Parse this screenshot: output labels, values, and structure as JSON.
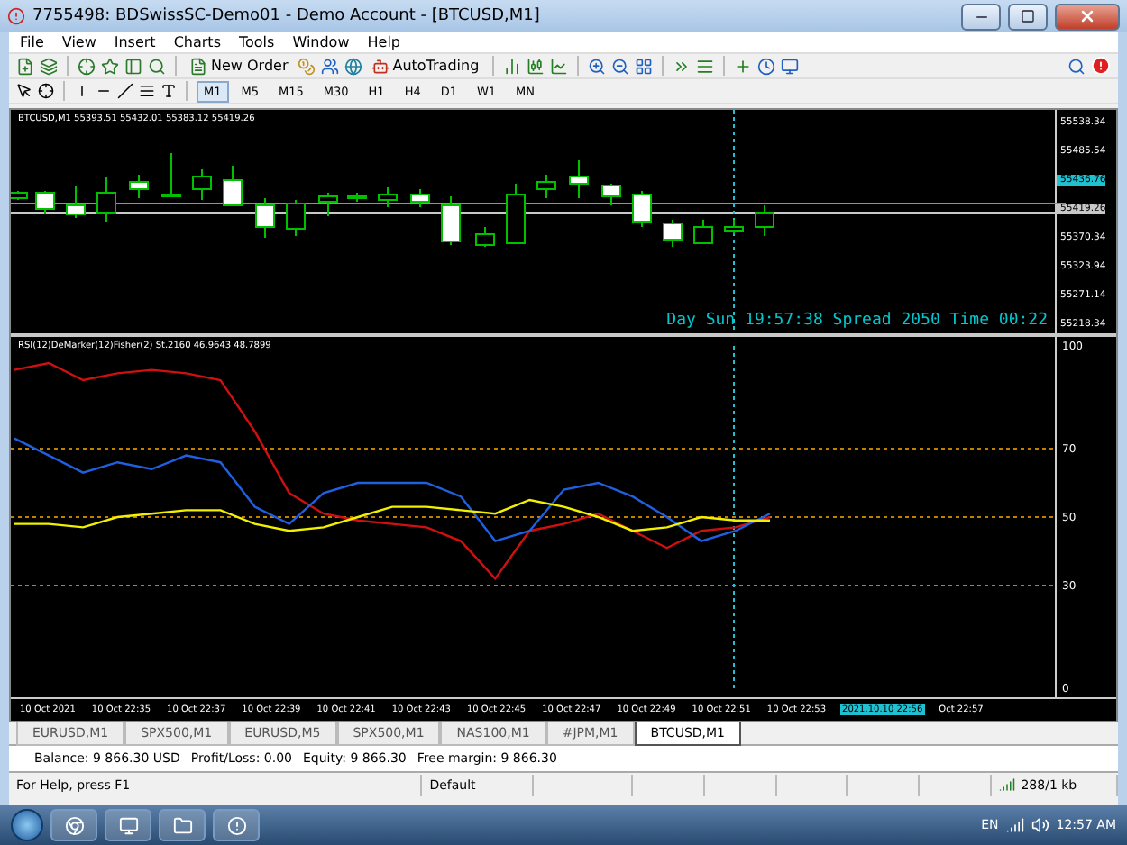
{
  "window": {
    "title": "7755498: BDSwissSC-Demo01 - Demo Account - [BTCUSD,M1]"
  },
  "menu": [
    "File",
    "View",
    "Insert",
    "Charts",
    "Tools",
    "Window",
    "Help"
  ],
  "toolbar": {
    "new_order": "New Order",
    "auto_trading": "AutoTrading"
  },
  "timeframes": [
    {
      "label": "M1",
      "selected": true
    },
    {
      "label": "M5",
      "selected": false
    },
    {
      "label": "M15",
      "selected": false
    },
    {
      "label": "M30",
      "selected": false
    },
    {
      "label": "H1",
      "selected": false
    },
    {
      "label": "H4",
      "selected": false
    },
    {
      "label": "D1",
      "selected": false
    },
    {
      "label": "W1",
      "selected": false
    },
    {
      "label": "MN",
      "selected": false
    }
  ],
  "chart": {
    "symbol": "BTCUSD,M1",
    "ohlc": "55393.51 55432.01 55383.12 55419.26",
    "info": "Day Sun 19:57:38 Spread 2050 Time 00:22",
    "price_ticks": [
      {
        "label": "55538.34",
        "kind": "plain"
      },
      {
        "label": "55485.54",
        "kind": "plain"
      },
      {
        "label": "55436.76",
        "kind": "ask"
      },
      {
        "label": "55419.26",
        "kind": "bid"
      },
      {
        "label": "55370.34",
        "kind": "plain"
      },
      {
        "label": "55323.94",
        "kind": "plain"
      },
      {
        "label": "55271.14",
        "kind": "plain"
      },
      {
        "label": "55218.34",
        "kind": "plain"
      }
    ]
  },
  "indicator": {
    "label": "RSI(12)DeMarker(12)Fisher(2) St.2160 46.9643 48.7899",
    "chart_data": {
      "type": "line",
      "grid": true,
      "ylim": [
        0,
        100
      ],
      "yticks": [
        {
          "value": 0,
          "label": "0"
        },
        {
          "value": 30,
          "label": "30"
        },
        {
          "value": 50,
          "label": "50"
        },
        {
          "value": 70,
          "label": "70"
        },
        {
          "value": 100,
          "label": "100"
        }
      ],
      "series": [
        {
          "color": "#d01010",
          "values": [
            93,
            95,
            90,
            92,
            93,
            92,
            90,
            75,
            57,
            51,
            49,
            48,
            47,
            43,
            32,
            46,
            48,
            51,
            46,
            41,
            46,
            47,
            50
          ]
        },
        {
          "color": "#2060e0",
          "values": [
            73,
            68,
            63,
            66,
            64,
            68,
            66,
            53,
            48,
            57,
            60,
            60,
            60,
            56,
            43,
            46,
            58,
            60,
            56,
            50,
            43,
            46,
            51
          ]
        },
        {
          "color": "#f0f000",
          "values": [
            48,
            48,
            47,
            50,
            51,
            52,
            52,
            48,
            46,
            47,
            50,
            53,
            53,
            52,
            51,
            55,
            53,
            50,
            46,
            47,
            50,
            49,
            49
          ]
        }
      ]
    }
  },
  "time_axis": [
    {
      "label": "10 Oct 2021",
      "selected": false
    },
    {
      "label": "10 Oct 22:35",
      "selected": false
    },
    {
      "label": "10 Oct 22:37",
      "selected": false
    },
    {
      "label": "10 Oct 22:39",
      "selected": false
    },
    {
      "label": "10 Oct 22:41",
      "selected": false
    },
    {
      "label": "10 Oct 22:43",
      "selected": false
    },
    {
      "label": "10 Oct 22:45",
      "selected": false
    },
    {
      "label": "10 Oct 22:47",
      "selected": false
    },
    {
      "label": "10 Oct 22:49",
      "selected": false
    },
    {
      "label": "10 Oct 22:51",
      "selected": false
    },
    {
      "label": "10 Oct 22:53",
      "selected": false
    },
    {
      "label": "2021.10.10 22:56",
      "selected": true
    },
    {
      "label": "Oct 22:57",
      "selected": false
    }
  ],
  "chart_tabs": [
    {
      "label": "EURUSD,M1",
      "selected": false
    },
    {
      "label": "SPX500,M1",
      "selected": false
    },
    {
      "label": "EURUSD,M5",
      "selected": false
    },
    {
      "label": "SPX500,M1",
      "selected": false
    },
    {
      "label": "NAS100,M1",
      "selected": false
    },
    {
      "label": "#JPM,M1",
      "selected": false
    },
    {
      "label": "BTCUSD,M1",
      "selected": true
    }
  ],
  "terminal": [
    "Balance: 9 866.30 USD",
    "Profit/Loss: 0.00",
    "Equity: 9 866.30",
    "Free margin: 9 866.30"
  ],
  "status_bar": {
    "help": "For Help, press F1",
    "profile": "Default",
    "traffic": "288/1 kb"
  },
  "taskbar": {
    "language": "EN",
    "clock": "12:57 AM"
  }
}
